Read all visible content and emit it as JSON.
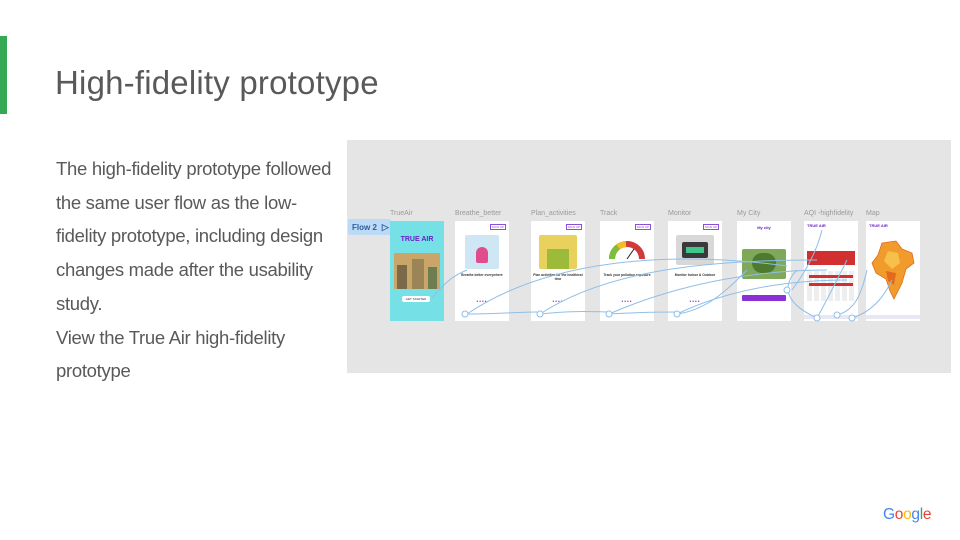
{
  "slide": {
    "title": "High-fidelity prototype",
    "body": [
      "The high-fidelity prototype followed the same user flow as the low-fidelity prototype, including design changes made after the usability study.",
      "View the True Air high-fidelity prototype"
    ],
    "accent_color": "#34a853"
  },
  "prototype_canvas": {
    "flow_label": "Flow 2",
    "frames": [
      {
        "label": "TrueAir",
        "caption": "TRUE AIR",
        "button": "GET STARTED"
      },
      {
        "label": "Breathe_better",
        "caption": "Breathe better everywhere"
      },
      {
        "label": "Plan_activities",
        "caption": "Plan activities for the healthiest time"
      },
      {
        "label": "Track",
        "caption": "Track your pollution exposure"
      },
      {
        "label": "Monitor",
        "caption": "Monitor Indoor & Outdoor"
      },
      {
        "label": "My City",
        "caption": "My city"
      },
      {
        "label": "AQI -highfidelity",
        "caption": "TRUE AIR"
      },
      {
        "label": "Map",
        "caption": "TRUE AIR"
      }
    ],
    "signup_label": "SIGN UP",
    "canvas_color": "#e5e5e5",
    "wire_color": "#8fbfe8"
  },
  "footer": {
    "logo_letters": [
      {
        "char": "G",
        "color": "#4285f4"
      },
      {
        "char": "o",
        "color": "#ea4335"
      },
      {
        "char": "o",
        "color": "#fbbc05"
      },
      {
        "char": "g",
        "color": "#4285f4"
      },
      {
        "char": "l",
        "color": "#34a853"
      },
      {
        "char": "e",
        "color": "#ea4335"
      }
    ]
  }
}
